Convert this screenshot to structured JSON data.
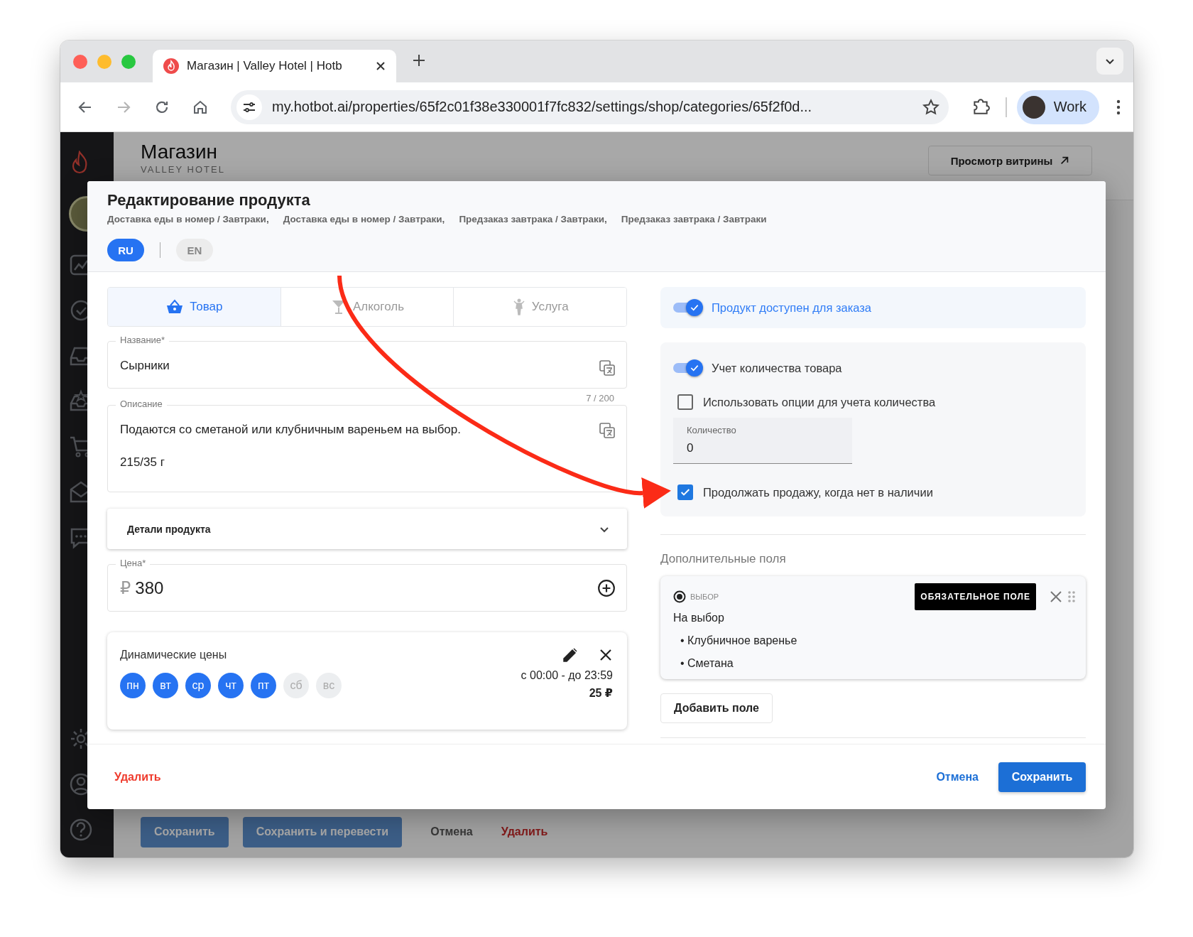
{
  "browser": {
    "tab_title": "Магазин | Valley Hotel | Hotb",
    "url": "my.hotbot.ai/properties/65f2c01f38e330001f7fc832/settings/shop/categories/65f2f0d...",
    "profile": "Work"
  },
  "page": {
    "title": "Магазин",
    "subtitle": "VALLEY HOTEL",
    "storefront_button": "Просмотр витрины",
    "footer_buttons": [
      {
        "label": "Сохранить",
        "kind": "primary"
      },
      {
        "label": "Сохранить и перевести",
        "kind": "primary"
      },
      {
        "label": "Отмена",
        "kind": "text"
      },
      {
        "label": "Удалить",
        "kind": "danger"
      }
    ]
  },
  "dialog": {
    "title": "Редактирование продукта",
    "categories": [
      "Доставка еды в номер / Завтраки,",
      "Доставка еды в номер / Завтраки,",
      "Предзаказ завтрака / Завтраки,",
      "Предзаказ завтрака / Завтраки"
    ],
    "languages": [
      {
        "label": "RU",
        "selected": true
      },
      {
        "label": "EN",
        "selected": false
      }
    ],
    "product_types": [
      {
        "label": "Товар",
        "kind": "basket",
        "selected": true
      },
      {
        "label": "Алкоголь",
        "kind": "glass",
        "selected": false
      },
      {
        "label": "Услуга",
        "kind": "person",
        "selected": false
      }
    ],
    "name_field": {
      "label": "Название*",
      "value": "Сырники",
      "counter": "7 / 200"
    },
    "description_field": {
      "label": "Описание",
      "value": "Подаются со сметаной или клубничным вареньем на выбор.\n\n215/35 г"
    },
    "details": {
      "label": "Детали продукта",
      "expanded": false
    },
    "price_field": {
      "label": "Цена*",
      "currency": "₽",
      "value": "380"
    },
    "dynamic_prices": {
      "title": "Динамические цены",
      "days": [
        {
          "label": "пн",
          "selected": true
        },
        {
          "label": "вт",
          "selected": true
        },
        {
          "label": "ср",
          "selected": true
        },
        {
          "label": "чт",
          "selected": true
        },
        {
          "label": "пт",
          "selected": true
        },
        {
          "label": "сб",
          "selected": false
        },
        {
          "label": "вс",
          "selected": false
        }
      ],
      "time": "с 00:00 - до 23:59",
      "price": "25 ₽"
    },
    "available": {
      "label": "Продукт доступен для заказа",
      "on": true
    },
    "inventory": [
      {
        "kind": "toggle",
        "label": "Учет количества товара",
        "on": true
      },
      {
        "kind": "checkbox",
        "label": "Использовать опции для учета количества",
        "checked": false
      },
      {
        "kind": "field",
        "label": "Количество",
        "value": "0"
      },
      {
        "kind": "checkbox",
        "label": "Продолжать продажу, когда нет в наличии",
        "checked": true
      }
    ],
    "extra_fields": {
      "title": "Дополнительные поля",
      "fields": [
        {
          "type_label": "ВЫБОР",
          "required_label": "ОБЯЗАТЕЛЬНОЕ ПОЛЕ",
          "name": "На выбор",
          "options": [
            "• Клубничное варенье",
            "• Сметана"
          ]
        }
      ],
      "add_button": "Добавить поле"
    },
    "footer": {
      "delete": "Удалить",
      "cancel": "Отмена",
      "save": "Сохранить"
    }
  }
}
